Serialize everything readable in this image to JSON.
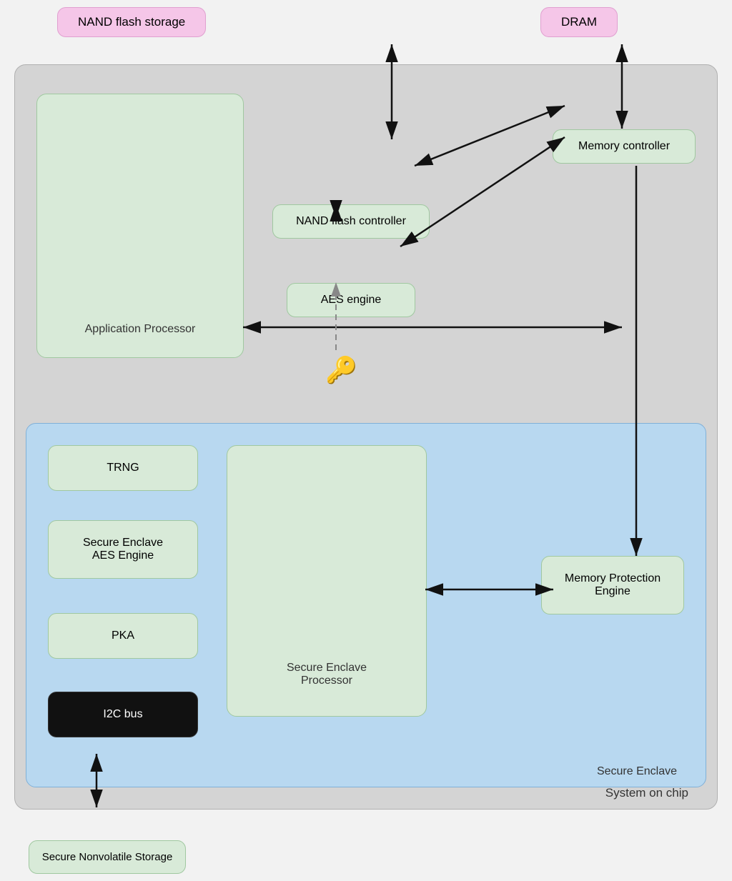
{
  "external": {
    "nand_flash_storage": "NAND flash storage",
    "dram": "DRAM"
  },
  "soc": {
    "label": "System on chip",
    "app_processor": "Application Processor",
    "nand_flash_controller": "NAND flash controller",
    "aes_engine": "AES engine",
    "memory_controller": "Memory controller"
  },
  "secure_enclave": {
    "label": "Secure Enclave",
    "trng": "TRNG",
    "se_aes_engine": "Secure Enclave\nAES Engine",
    "pka": "PKA",
    "i2c_bus": "I2C bus",
    "se_processor": "Secure Enclave\nProcessor",
    "mpe": "Memory Protection\nEngine"
  },
  "external_bottom": {
    "secure_nvs": "Secure Nonvolatile Storage"
  }
}
